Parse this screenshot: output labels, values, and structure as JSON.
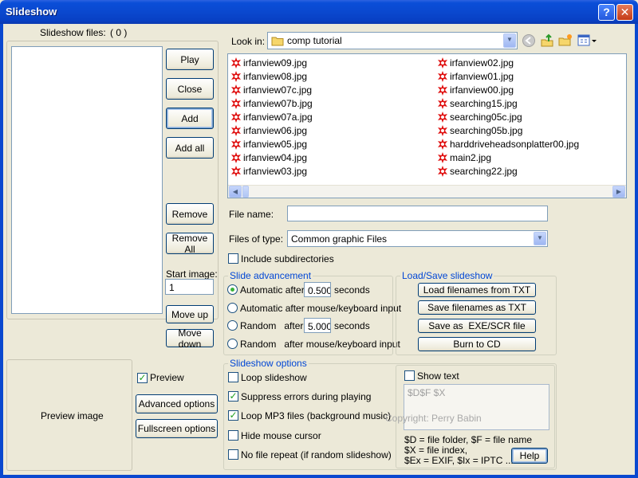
{
  "window": {
    "title": "Slideshow",
    "help_glyph": "?",
    "close_glyph": "✕"
  },
  "slideshow_files": {
    "label": "Slideshow files:",
    "count": "( 0 )"
  },
  "left_buttons": {
    "play": "Play",
    "close": "Close",
    "add": "Add",
    "add_all": "Add all",
    "remove": "Remove",
    "remove_all": "Remove All",
    "move_up": "Move up",
    "move_down": "Move down"
  },
  "start_image": {
    "label": "Start image:",
    "value": "1"
  },
  "preview": {
    "image_label": "Preview image",
    "checkbox_label": "Preview",
    "checked": true,
    "advanced_button": "Advanced options",
    "fullscreen_button": "Fullscreen options"
  },
  "look_in": {
    "label": "Look in:",
    "value": "comp tutorial"
  },
  "toolbar_icons": [
    "back-icon",
    "up-folder-icon",
    "new-folder-icon",
    "view-menu-icon"
  ],
  "files_col1": [
    "irfanview09.jpg",
    "irfanview08.jpg",
    "irfanview07c.jpg",
    "irfanview07b.jpg",
    "irfanview07a.jpg",
    "irfanview06.jpg",
    "irfanview05.jpg",
    "irfanview04.jpg",
    "irfanview03.jpg"
  ],
  "files_col2": [
    "irfanview02.jpg",
    "irfanview01.jpg",
    "irfanview00.jpg",
    "searching15.jpg",
    "searching05c.jpg",
    "searching05b.jpg",
    "harddriveheadsonplatter00.jpg",
    "main2.jpg",
    "searching22.jpg"
  ],
  "file_name": {
    "label": "File name:",
    "value": ""
  },
  "files_of_type": {
    "label": "Files of type:",
    "value": "Common graphic Files"
  },
  "include_subdirs": {
    "label": "Include subdirectories",
    "checked": false
  },
  "slide_advancement": {
    "title": "Slide advancement",
    "automatic_label": "Automatic after",
    "automatic_value": "0.500",
    "seconds_1": "seconds",
    "automatic_mouse": "Automatic after mouse/keyboard input",
    "random_label": "Random   after",
    "random_value": "5.000",
    "seconds_2": "seconds",
    "random_mouse": "Random   after mouse/keyboard input"
  },
  "load_save": {
    "title": "Load/Save slideshow",
    "load_txt": "Load filenames from TXT",
    "save_txt": "Save filenames as TXT",
    "save_exe": "Save as  EXE/SCR file",
    "burn_cd": "Burn to CD"
  },
  "slideshow_options": {
    "title": "Slideshow options",
    "loop": {
      "label": "Loop slideshow",
      "checked": false
    },
    "suppress": {
      "label": "Suppress errors during playing",
      "checked": true
    },
    "loop_mp3": {
      "label": "Loop MP3 files (background music)",
      "checked": true
    },
    "hide_cursor": {
      "label": "Hide mouse cursor",
      "checked": false
    },
    "no_repeat": {
      "label": "No file repeat (if random slideshow)",
      "checked": false
    }
  },
  "show_text": {
    "label": "Show text",
    "checked": false,
    "text_value": "$D$F $X",
    "copyright": "Copyright: Perry Babin",
    "help_line1": "$D = file folder, $F = file name",
    "help_line2": "$X = file index,",
    "help_line3": "$Ex = EXIF, $Ix = IPTC ...",
    "help_button": "Help"
  },
  "colors": {
    "titlebar": "#0a48cf",
    "group_title": "#0046d5",
    "check_mark": "#21a121"
  }
}
